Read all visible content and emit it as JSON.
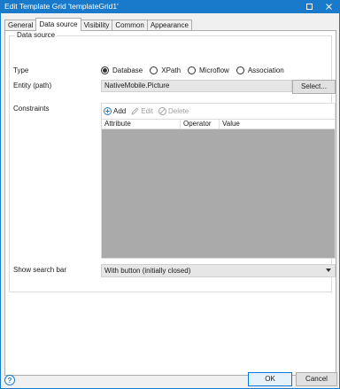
{
  "window": {
    "title": "Edit Template Grid 'templateGrid1'",
    "accent_color": "#1979ca"
  },
  "tabs": [
    {
      "label": "General",
      "active": false
    },
    {
      "label": "Data source",
      "active": true
    },
    {
      "label": "Visibility",
      "active": false
    },
    {
      "label": "Common",
      "active": false
    },
    {
      "label": "Appearance",
      "active": false
    }
  ],
  "data_source": {
    "group_title": "Data source",
    "type_label": "Type",
    "type_options": [
      "Database",
      "XPath",
      "Microflow",
      "Association"
    ],
    "type_selected": "Database",
    "entity_label": "Entity (path)",
    "entity_value": "NativeMobile.Picture",
    "select_button": "Select...",
    "constraints_label": "Constraints",
    "constraints_toolbar": {
      "add": "Add",
      "edit": "Edit",
      "delete": "Delete"
    },
    "constraints_columns": [
      "Attribute",
      "Operator",
      "Value"
    ],
    "constraints_rows": []
  },
  "search_bar": {
    "label": "Show search bar",
    "value": "With button (initially closed)"
  },
  "footer": {
    "help_icon": "question-icon",
    "help_text": "?",
    "ok": "OK",
    "cancel": "Cancel"
  }
}
